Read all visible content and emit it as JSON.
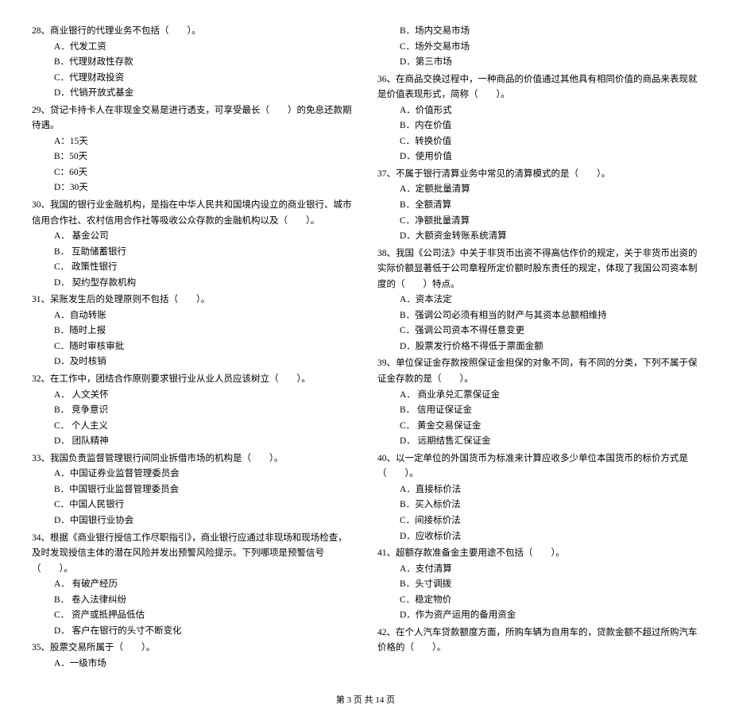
{
  "leftColumn": [
    {
      "stem": "28、商业银行的代理业务不包括（　　）。",
      "opts": [
        "A．代发工资",
        "B．代理财政性存款",
        "C．代理财政投资",
        "D．代销开放式基金"
      ]
    },
    {
      "stem": "29、贷记卡持卡人在非现金交易是进行透支，可享受最长（　　）的免息还款期待遇。",
      "opts": [
        "A：15天",
        "B：50天",
        "C：60天",
        "D：30天"
      ]
    },
    {
      "stem": "30、我国的银行业金融机构，是指在中华人民共和国境内设立的商业银行、城市信用合作社、农村信用合作社等吸收公众存款的金融机构以及（　　）。",
      "opts": [
        "A． 基金公司",
        "B． 互助储蓄银行",
        "C． 政策性银行",
        "D． 契约型存款机构"
      ]
    },
    {
      "stem": "31、呆账发生后的处理原则不包括（　　）。",
      "opts": [
        "A．自动转账",
        "B．随时上报",
        "C．随时审核审批",
        "D．及时核销"
      ]
    },
    {
      "stem": "32、在工作中，团结合作原则要求银行业从业人员应该树立（　　）。",
      "opts": [
        "A． 人文关怀",
        "B． 竞争意识",
        "C． 个人主义",
        "D． 团队精神"
      ]
    },
    {
      "stem": "33、我国负责监督管理银行间同业拆借市场的机构是（　　）。",
      "opts": [
        "A．中国证券业监督管理委员会",
        "B．中国银行业监督管理委员会",
        "C．中国人民银行",
        "D．中国银行业协会"
      ]
    },
    {
      "stem": "34、根据《商业银行授信工作尽职指引》，商业银行应通过非现场和现场检查，及时发现授信主体的潜在风险并发出预警风险提示。下列哪项是预警信号（　　）。",
      "opts": [
        "A． 有破产经历",
        "B． 卷入法律纠纷",
        "C． 资产或抵押品低估",
        "D． 客户在银行的头寸不断变化"
      ]
    },
    {
      "stem": "35、股票交易所属于（　　）。",
      "opts": [
        "A．一级市场"
      ]
    }
  ],
  "rightColumn": [
    {
      "opts": [
        "B．场内交易市场",
        "C．场外交易市场",
        "D．第三市场"
      ]
    },
    {
      "stem": "36、在商品交换过程中，一种商品的价值通过其他具有相同价值的商品来表现就是价值表现形式，简称（　　）。",
      "opts": [
        "A．价值形式",
        "B．内在价值",
        "C．转换价值",
        "D．使用价值"
      ]
    },
    {
      "stem": "37、不属于银行清算业务中常见的清算模式的是（　　）。",
      "opts": [
        "A．定额批量清算",
        "B．全额清算",
        "C．净额批量清算",
        "D．大额资金转账系统清算"
      ]
    },
    {
      "stem": "38、我国《公司法》中关于非货币出资不得高估作价的规定，关于非货币出资的实际价额显著低于公司章程所定价额时股东责任的规定，体现了我国公司资本制度的（　　）特点。",
      "opts": [
        "A．资本法定",
        "B．强调公司必须有相当的财产与其资本总额相维持",
        "C．强调公司资本不得任意变更",
        "D．股票发行价格不得低于票面金额"
      ]
    },
    {
      "stem": "39、单位保证金存款按照保证金担保的对象不同，有不同的分类，下列不属于保证金存款的是（　　）。",
      "opts": [
        "A． 商业承兑汇票保证金",
        "B． 信用证保证金",
        "C． 黄金交易保证金",
        "D． 远期结售汇保证金"
      ]
    },
    {
      "stem": "40、以一定单位的外国货币为标准来计算应收多少单位本国货币的标价方式是（　　）。",
      "opts": [
        "A．直接标价法",
        "B．买入标价法",
        "C．间接标价法",
        "D．应收标价法"
      ]
    },
    {
      "stem": "41、超额存款准备金主要用途不包括（　　）。",
      "opts": [
        "A．支付清算",
        "B．头寸调拨",
        "C．稳定物价",
        "D．作为资产运用的备用资金"
      ]
    },
    {
      "stem": "42、在个人汽车贷款额度方面，所购车辆为自用车的，贷款金额不超过所购汽车价格的（　　）。",
      "opts": []
    }
  ],
  "footer": "第 3 页 共 14 页"
}
